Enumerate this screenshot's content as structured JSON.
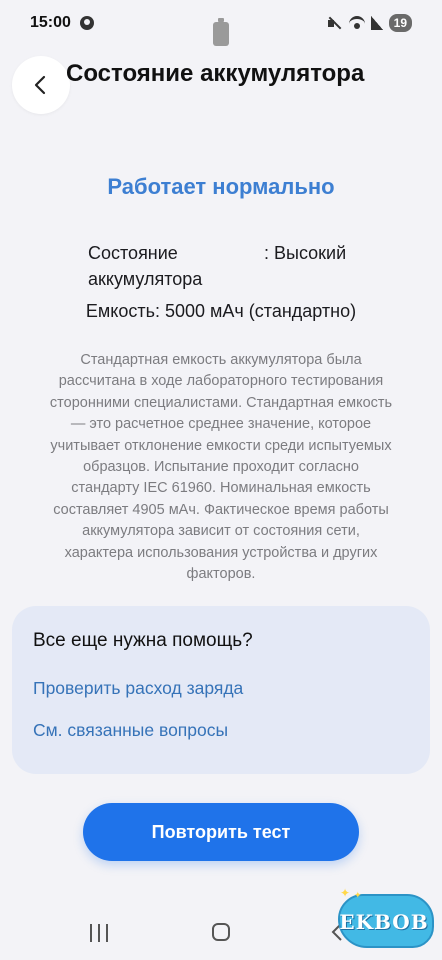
{
  "status_bar": {
    "time": "15:00",
    "battery_level": "19"
  },
  "header": {
    "title": "Состояние аккумулятора"
  },
  "main": {
    "status_heading": "Работает нормально",
    "state_label": "Состояние аккумулятора",
    "state_value": ": Высокий",
    "capacity": "Емкость: 5000 мАч (стандартно)",
    "description": "Стандартная емкость аккумулятора была рассчитана в ходе лабораторного тестирования сторонними специалистами. Стандартная емкость — это расчетное среднее значение, которое учитывает отклонение емкости среди испытуемых образцов. Испытание проходит согласно стандарту IEC 61960. Номинальная емкость составляет 4905 мАч. Фактическое время работы аккумулятора зависит от состояния сети, характера использования устройства и других факторов."
  },
  "help": {
    "title": "Все еще нужна помощь?",
    "links": [
      "Проверить расход заряда",
      "См. связанные вопросы"
    ]
  },
  "retry_button": "Повторить тест",
  "watermark": "EKBOB",
  "colors": {
    "accent": "#3d7fd2",
    "link": "#3673b8",
    "button": "#1f73ea",
    "card": "#e4e9f6",
    "background": "#f3f3f7"
  }
}
